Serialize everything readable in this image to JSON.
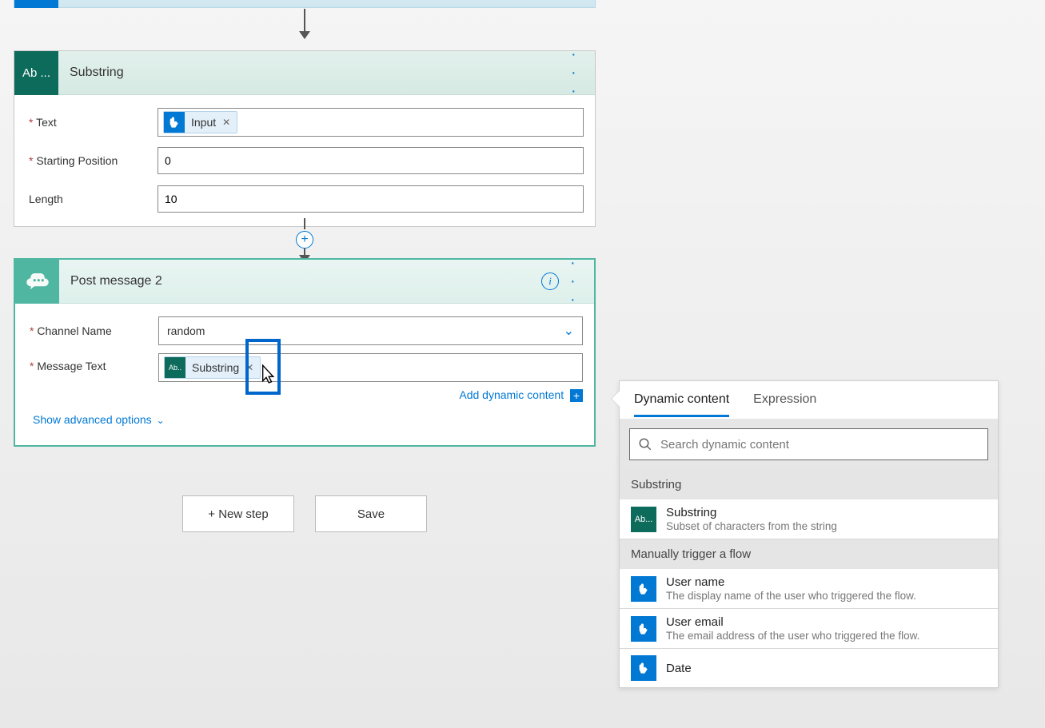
{
  "substring_card": {
    "icon_label": "Ab ...",
    "title": "Substring",
    "fields": {
      "text_label": "Text",
      "text_token": {
        "icon": "tap",
        "label": "Input"
      },
      "start_label": "Starting Position",
      "start_value": "0",
      "length_label": "Length",
      "length_value": "10"
    }
  },
  "post_card": {
    "title": "Post message 2",
    "fields": {
      "channel_label": "Channel Name",
      "channel_value": "random",
      "message_label": "Message Text",
      "message_token": {
        "icon": "Ab...",
        "label": "Substring"
      }
    },
    "add_dynamic": "Add dynamic content",
    "advanced": "Show advanced options"
  },
  "buttons": {
    "new_step": "+ New step",
    "save": "Save"
  },
  "dc_panel": {
    "tabs": {
      "dynamic": "Dynamic content",
      "expression": "Expression"
    },
    "search_placeholder": "Search dynamic content",
    "groups": [
      {
        "title": "Substring",
        "items": [
          {
            "icon_color": "green",
            "icon_text": "Ab...",
            "name": "Substring",
            "desc": "Subset of characters from the string"
          }
        ]
      },
      {
        "title": "Manually trigger a flow",
        "items": [
          {
            "icon_color": "blue",
            "icon_text": "",
            "name": "User name",
            "desc": "The display name of the user who triggered the flow."
          },
          {
            "icon_color": "blue",
            "icon_text": "",
            "name": "User email",
            "desc": "The email address of the user who triggered the flow."
          },
          {
            "icon_color": "blue",
            "icon_text": "",
            "name": "Date",
            "desc": ""
          }
        ]
      }
    ]
  }
}
